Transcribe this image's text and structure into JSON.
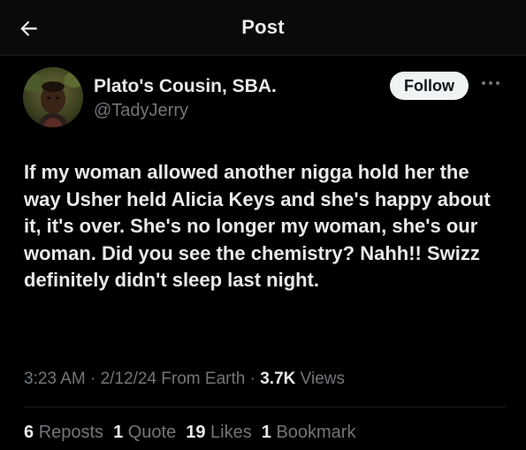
{
  "header": {
    "title": "Post",
    "back_icon": "arrow-left-icon"
  },
  "author": {
    "name": "Plato's Cousin, SBA.",
    "handle": "@TadyJerry",
    "avatar_icon": "avatar-photo"
  },
  "follow_label": "Follow",
  "more_icon": "more-horizontal-icon",
  "post": {
    "text": "If my woman allowed another nigga hold her the way Usher held Alicia Keys and she's happy about it, it's over. She's no longer my woman, she's our woman. Did you see the chemistry? Nahh!! Swizz definitely didn't sleep last night."
  },
  "meta": {
    "time": "3:23 AM",
    "separator": "·",
    "date": "2/12/24",
    "source": "From Earth",
    "views_count": "3.7K",
    "views_label": "Views"
  },
  "stats": {
    "reposts_count": "6",
    "reposts_label": "Reposts",
    "quotes_count": "1",
    "quotes_label": "Quote",
    "likes_count": "19",
    "likes_label": "Likes",
    "bookmarks_count": "1",
    "bookmarks_label": "Bookmark"
  },
  "colors": {
    "background": "#000000",
    "text_primary": "#e7e9ea",
    "text_secondary": "#71767b",
    "follow_bg": "#eff3f4"
  }
}
